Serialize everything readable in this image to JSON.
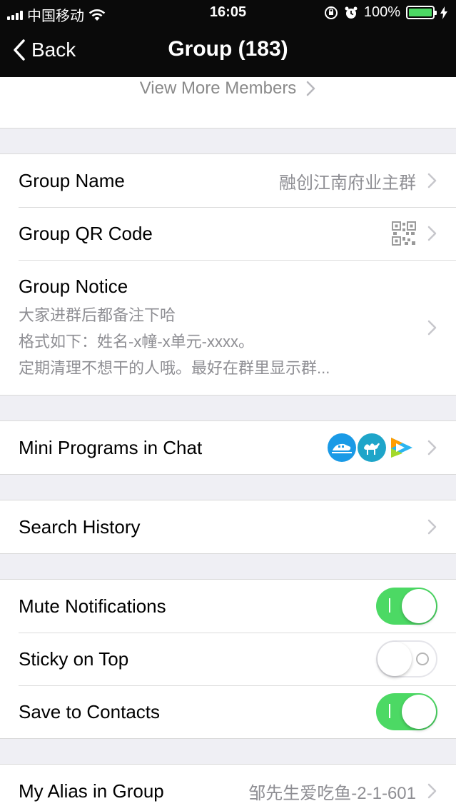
{
  "status_bar": {
    "carrier": "中国移动",
    "time": "16:05",
    "battery_percent": "100%",
    "battery_level": 1.0,
    "icons": [
      "signal-icon",
      "wifi-icon",
      "orientation-lock-icon",
      "alarm-icon",
      "battery-icon",
      "charging-icon"
    ]
  },
  "nav": {
    "back_label": "Back",
    "title": "Group (183)"
  },
  "members": {
    "view_more_label": "View More Members"
  },
  "rows": {
    "group_name": {
      "label": "Group Name",
      "value": "融创江南府业主群"
    },
    "group_qr": {
      "label": "Group QR Code"
    },
    "group_notice": {
      "label": "Group Notice",
      "lines": [
        "大家进群后都备注下哈",
        "格式如下：姓名-x幢-x单元-xxxx。",
        "定期清理不想干的人哦。最好在群里显示群..."
      ]
    },
    "mini_programs": {
      "label": "Mini Programs in Chat",
      "icons": [
        "train-icon",
        "camel-icon",
        "video-play-icon"
      ]
    },
    "search_history": {
      "label": "Search History"
    },
    "mute": {
      "label": "Mute Notifications",
      "on": true
    },
    "sticky": {
      "label": "Sticky on Top",
      "on": false
    },
    "save_contacts": {
      "label": "Save to Contacts",
      "on": true
    },
    "alias": {
      "label": "My Alias in Group",
      "value": "邹先生爱吃鱼-2-1-601"
    }
  },
  "colors": {
    "toggle_on": "#4cd964",
    "nav_background": "#0a0a0a",
    "page_background": "#efeff4",
    "secondary_text": "#8e8e93"
  }
}
